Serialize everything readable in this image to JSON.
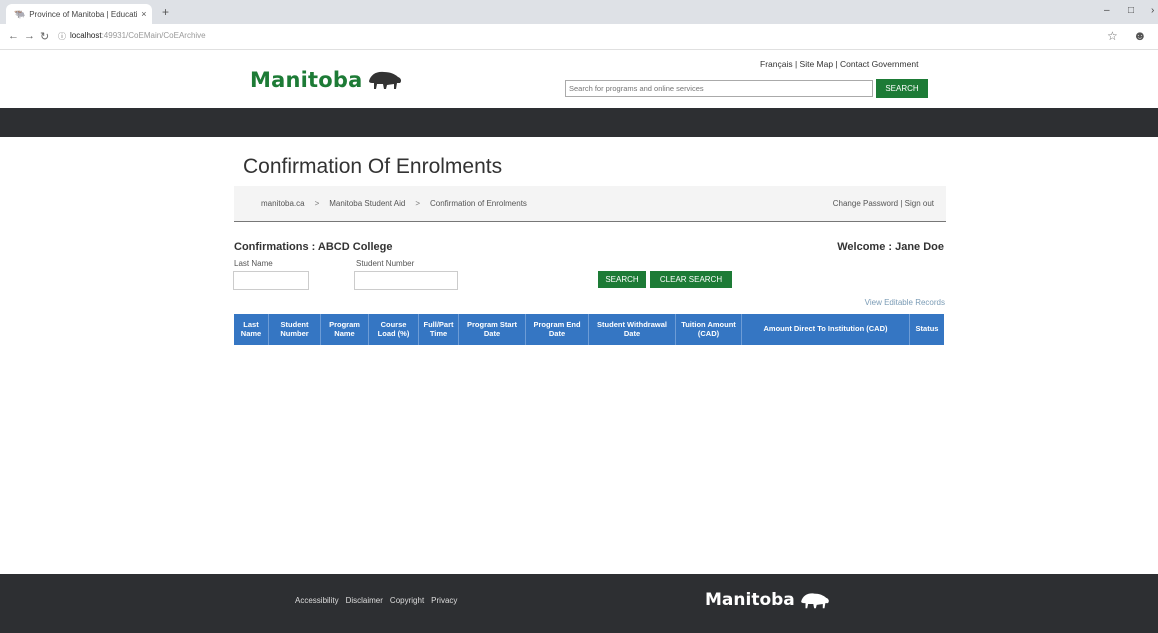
{
  "browser": {
    "tab_title": "Province of Manitoba | Educatio",
    "tab_close": "×",
    "new_tab": "+",
    "url_host": "localhost",
    "url_path": ":49931/CoEMain/CoEArchive"
  },
  "header": {
    "logo_text": "Manitoba",
    "top_links": "Français  | Site Map | Contact Government",
    "search_placeholder": "Search for programs and online services",
    "search_button": "SEARCH"
  },
  "page": {
    "title": "Confirmation Of Enrolments",
    "breadcrumb": [
      "manitoba.ca",
      "Manitoba Student Aid",
      "Confirmation of Enrolments"
    ],
    "breadcrumb_sep": ">",
    "account_links": "Change Password | Sign out",
    "confirmations_title": "Confirmations : ABCD College",
    "welcome": "Welcome : Jane Doe",
    "last_name_label": "Last Name",
    "student_number_label": "Student Number",
    "search_button": "SEARCH",
    "clear_button": "CLEAR SEARCH",
    "view_link": "View Editable Records"
  },
  "table": {
    "columns": [
      "Last Name",
      "Student Number",
      "Program Name",
      "Course Load (%)",
      "Full/Part Time",
      "Program Start Date",
      "Program End Date",
      "Student Withdrawal Date",
      "Tuition Amount (CAD)",
      "Amount Direct To Institution (CAD)",
      "Status"
    ]
  },
  "footer": {
    "links": [
      "Accessibility",
      "Disclaimer",
      "Copyright",
      "Privacy"
    ],
    "logo_text": "Manitoba"
  },
  "colors": {
    "brand_green": "#1d7b36",
    "dark_bar": "#2d2f32",
    "table_header": "#3576c3"
  }
}
